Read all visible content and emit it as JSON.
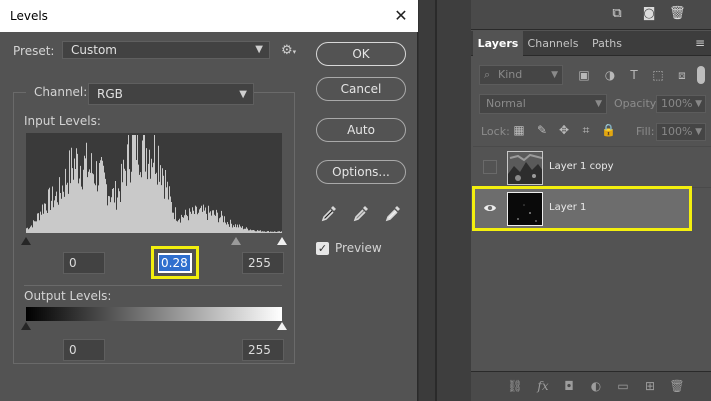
{
  "dialog": {
    "title": "Levels",
    "close_glyph": "✕",
    "preset_label": "Preset:",
    "preset_value": "Custom",
    "channel_label": "Channel:",
    "channel_value": "RGB",
    "input_levels_label": "Input Levels:",
    "output_levels_label": "Output Levels:",
    "input_black": "0",
    "input_gamma": "0.28",
    "input_white": "255",
    "output_black": "0",
    "output_white": "255",
    "buttons": {
      "ok": "OK",
      "cancel": "Cancel",
      "auto": "Auto",
      "options": "Options..."
    },
    "preview_label": "Preview",
    "preview_checked": true,
    "input_slider_positions": {
      "black": 0,
      "gamma": 0.82,
      "white": 1
    },
    "icons": [
      "settings-gear-icon",
      "black-eyedropper-icon",
      "gray-eyedropper-icon",
      "white-eyedropper-icon"
    ]
  },
  "panel": {
    "tabs": [
      {
        "label": "Layers",
        "active": true
      },
      {
        "label": "Channels",
        "active": false
      },
      {
        "label": "Paths",
        "active": false
      }
    ],
    "filter_placeholder": "Kind",
    "blend_mode": "Normal",
    "opacity_label": "Opacity:",
    "opacity_value": "100%",
    "lock_label": "Lock:",
    "fill_label": "Fill:",
    "fill_value": "100%",
    "layers": [
      {
        "name": "Layer 1 copy",
        "visible": false,
        "selected": false
      },
      {
        "name": "Layer 1",
        "visible": true,
        "selected": true
      }
    ]
  },
  "colors": {
    "highlight": "#f3ef0e",
    "selection": "#2f6fce",
    "dialog_bg": "#535353"
  }
}
